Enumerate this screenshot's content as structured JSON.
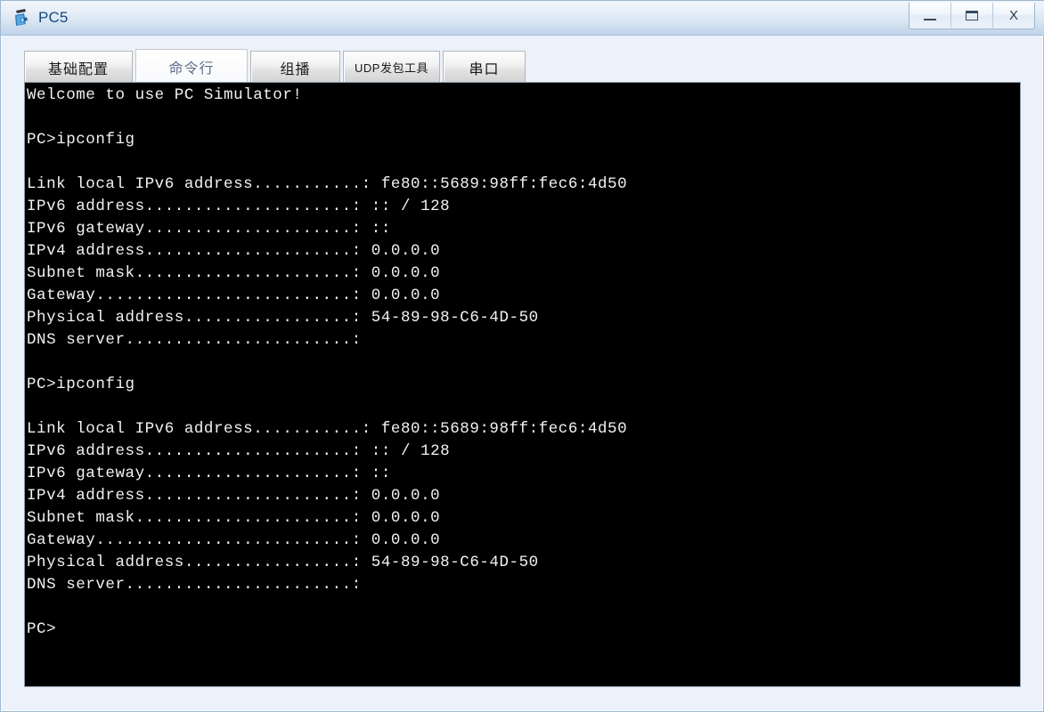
{
  "window": {
    "title": "PC5",
    "icon": "pc-simulator-icon",
    "frame_color": "#ecf2fb",
    "titlebar_accent": "#16497e",
    "controls": [
      {
        "name": "minimize",
        "label": "_"
      },
      {
        "name": "maximize",
        "label": "□"
      },
      {
        "name": "close",
        "label": "X"
      }
    ]
  },
  "tabs": [
    {
      "id": "basic-config",
      "label": "基础配置",
      "active": false,
      "small": false
    },
    {
      "id": "command-line",
      "label": "命令行",
      "active": true,
      "small": false
    },
    {
      "id": "multicast",
      "label": "组播",
      "active": false,
      "small": false
    },
    {
      "id": "udp-packet-tool",
      "label": "UDP发包工具",
      "active": false,
      "small": true
    },
    {
      "id": "serial-port",
      "label": "串口",
      "active": false,
      "small": false
    }
  ],
  "terminal": {
    "background": "#000000",
    "foreground": "#f2f2f2",
    "banner": "Welcome to use PC Simulator!",
    "prompt": "PC>",
    "command": "ipconfig",
    "fields": {
      "link_local_ipv6": {
        "label": "Link local IPv6 address",
        "value": "fe80::5689:98ff:fec6:4d50"
      },
      "ipv6_address": {
        "label": "IPv6 address",
        "value": ":: / 128"
      },
      "ipv6_gateway": {
        "label": "IPv6 gateway",
        "value": "::"
      },
      "ipv4_address": {
        "label": "IPv4 address",
        "value": "0.0.0.0"
      },
      "subnet_mask": {
        "label": "Subnet mask",
        "value": "0.0.0.0"
      },
      "gateway": {
        "label": "Gateway",
        "value": "0.0.0.0"
      },
      "physical_address": {
        "label": "Physical address",
        "value": "54-89-98-C6-4D-50"
      },
      "dns_server": {
        "label": "DNS server",
        "value": ""
      }
    },
    "content": "Welcome to use PC Simulator!\n\nPC>ipconfig\n\nLink local IPv6 address...........: fe80::5689:98ff:fec6:4d50\nIPv6 address.....................: :: / 128\nIPv6 gateway.....................: ::\nIPv4 address.....................: 0.0.0.0\nSubnet mask......................: 0.0.0.0\nGateway..........................: 0.0.0.0\nPhysical address.................: 54-89-98-C6-4D-50\nDNS server.......................:\n\nPC>ipconfig\n\nLink local IPv6 address...........: fe80::5689:98ff:fec6:4d50\nIPv6 address.....................: :: / 128\nIPv6 gateway.....................: ::\nIPv4 address.....................: 0.0.0.0\nSubnet mask......................: 0.0.0.0\nGateway..........................: 0.0.0.0\nPhysical address.................: 54-89-98-C6-4D-50\nDNS server.......................:\n\nPC>"
  }
}
